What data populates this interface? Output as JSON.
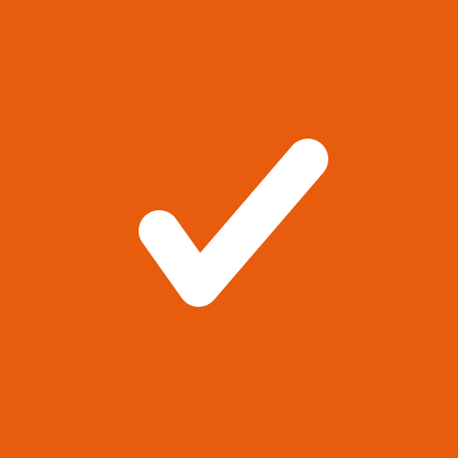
{
  "icon": {
    "name": "checkmark-icon",
    "background_color": "#E85C0D",
    "foreground_color": "#FFFFFF"
  }
}
